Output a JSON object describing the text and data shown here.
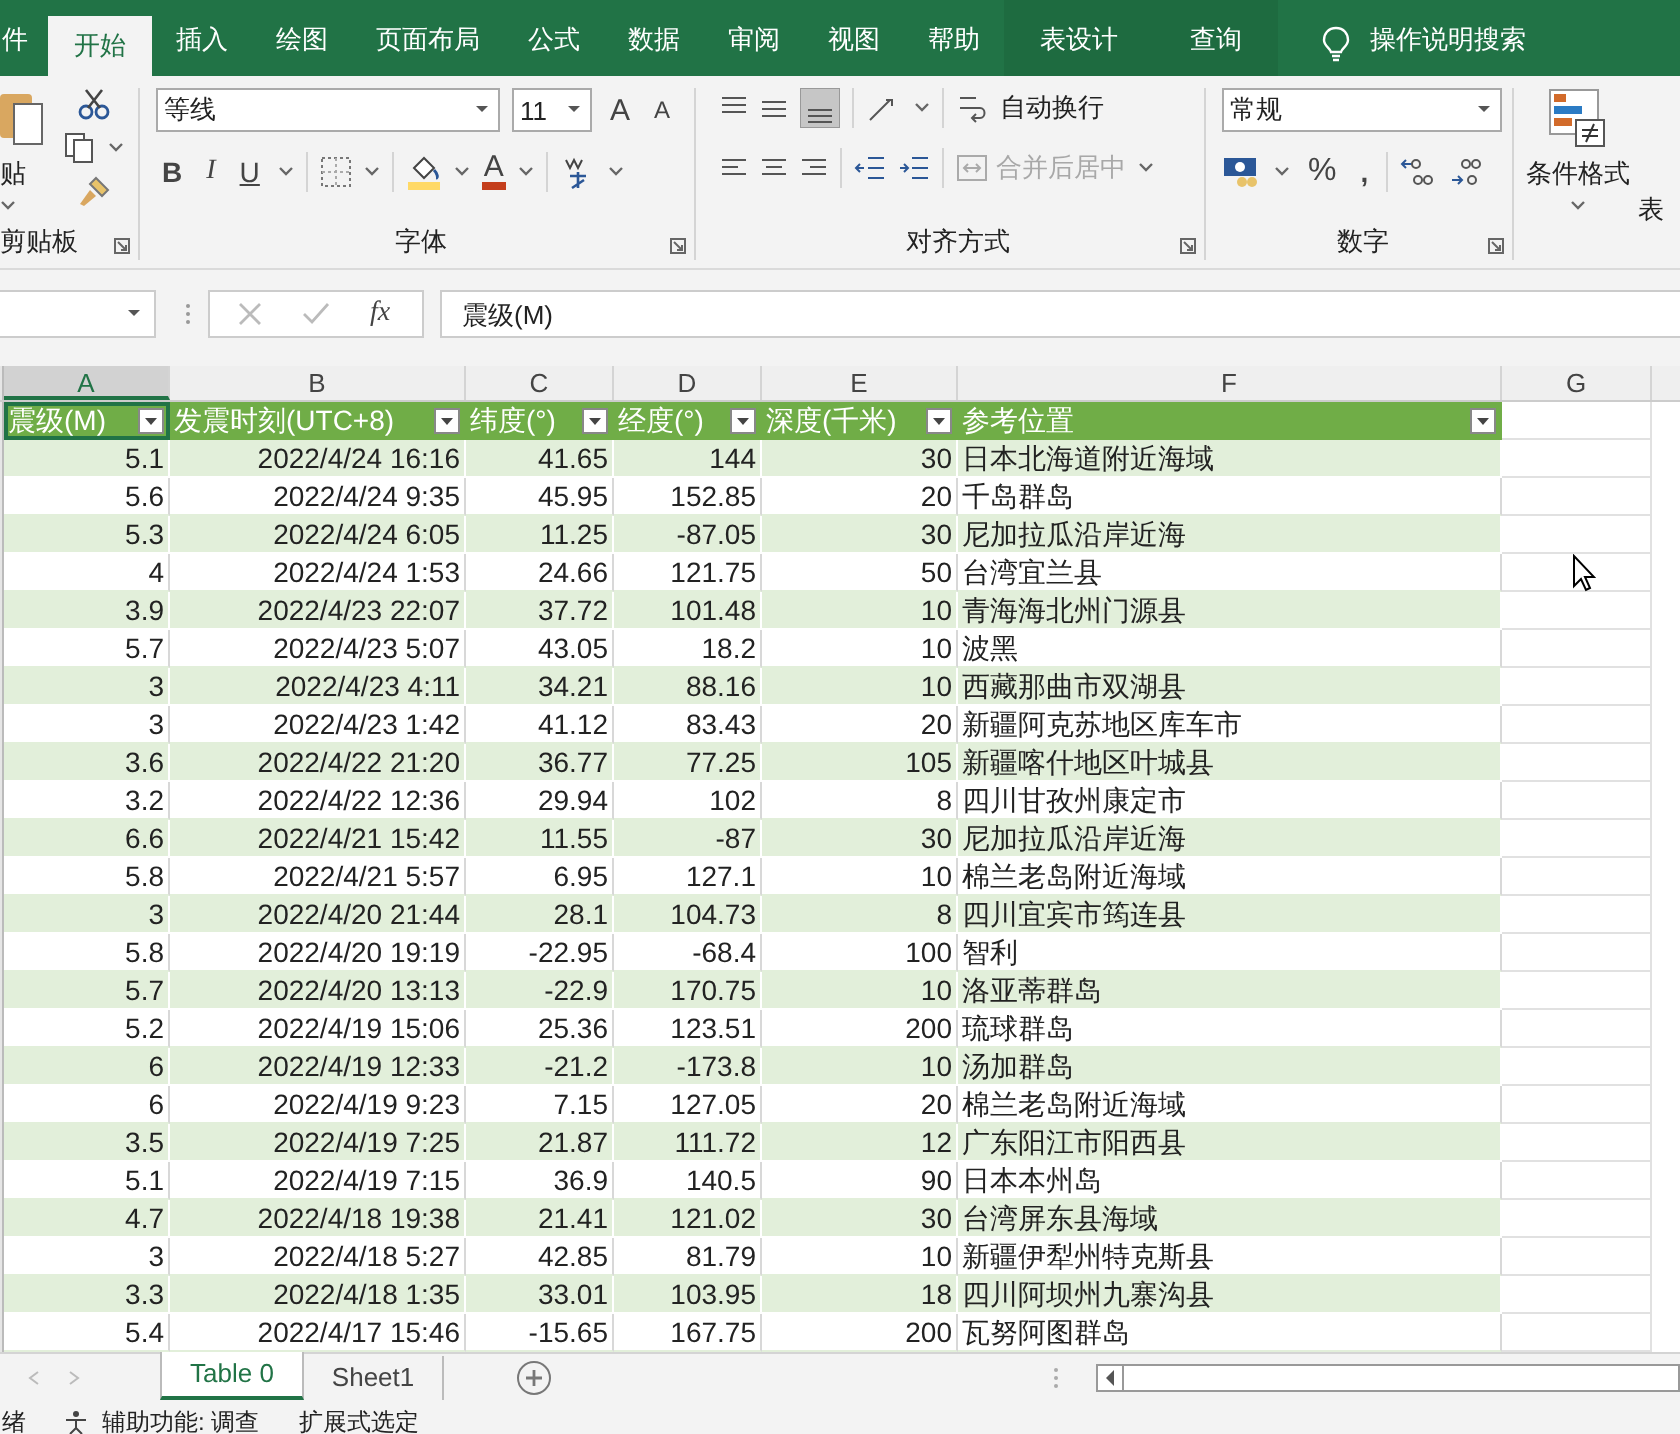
{
  "ribbon_tabs": [
    {
      "label": "件",
      "selected": false
    },
    {
      "label": "开始",
      "selected": true
    },
    {
      "label": "插入",
      "selected": false
    },
    {
      "label": "绘图",
      "selected": false
    },
    {
      "label": "页面布局",
      "selected": false
    },
    {
      "label": "公式",
      "selected": false
    },
    {
      "label": "数据",
      "selected": false
    },
    {
      "label": "审阅",
      "selected": false
    },
    {
      "label": "视图",
      "selected": false
    },
    {
      "label": "帮助",
      "selected": false
    },
    {
      "label": "表设计",
      "selected": false,
      "contextual": true
    },
    {
      "label": "查询",
      "selected": false,
      "contextual": true
    }
  ],
  "tell_me": "操作说明搜索",
  "clipboard": {
    "paste": "贴",
    "label": "剪贴板"
  },
  "font": {
    "name": "等线",
    "size": "11",
    "grow": "A",
    "shrink": "A",
    "bold": "B",
    "italic": "I",
    "underline": "U",
    "color_letter": "A",
    "label": "字体"
  },
  "alignment": {
    "wrap": "自动换行",
    "merge": {
      "label": "合并后居中",
      "disabled": true
    },
    "label": "对齐方式"
  },
  "number": {
    "format": "常规",
    "percent": "%",
    "comma": ",",
    "label": "数字"
  },
  "styles": {
    "conditional": "条件格式",
    "table_format": "表"
  },
  "formula_bar": {
    "fx": "fx",
    "value": "震级(M)"
  },
  "column_letters": [
    {
      "label": "A",
      "selected": true
    },
    {
      "label": "B",
      "selected": false
    },
    {
      "label": "C",
      "selected": false
    },
    {
      "label": "D",
      "selected": false
    },
    {
      "label": "E",
      "selected": false
    },
    {
      "label": "F",
      "selected": false
    },
    {
      "label": "G",
      "selected": false
    }
  ],
  "table": {
    "columns": [
      "震级(M)",
      "发震时刻(UTC+8)",
      "纬度(°)",
      "经度(°)",
      "深度(千米)",
      "参考位置"
    ],
    "rows": [
      [
        "5.1",
        "2022/4/24 16:16",
        "41.65",
        "144",
        "30",
        "日本北海道附近海域"
      ],
      [
        "5.6",
        "2022/4/24 9:35",
        "45.95",
        "152.85",
        "20",
        "千岛群岛"
      ],
      [
        "5.3",
        "2022/4/24 6:05",
        "11.25",
        "-87.05",
        "30",
        "尼加拉瓜沿岸近海"
      ],
      [
        "4",
        "2022/4/24 1:53",
        "24.66",
        "121.75",
        "50",
        "台湾宜兰县"
      ],
      [
        "3.9",
        "2022/4/23 22:07",
        "37.72",
        "101.48",
        "10",
        "青海海北州门源县"
      ],
      [
        "5.7",
        "2022/4/23 5:07",
        "43.05",
        "18.2",
        "10",
        "波黑"
      ],
      [
        "3",
        "2022/4/23 4:11",
        "34.21",
        "88.16",
        "10",
        "西藏那曲市双湖县"
      ],
      [
        "3",
        "2022/4/23 1:42",
        "41.12",
        "83.43",
        "20",
        "新疆阿克苏地区库车市"
      ],
      [
        "3.6",
        "2022/4/22 21:20",
        "36.77",
        "77.25",
        "105",
        "新疆喀什地区叶城县"
      ],
      [
        "3.2",
        "2022/4/22 12:36",
        "29.94",
        "102",
        "8",
        "四川甘孜州康定市"
      ],
      [
        "6.6",
        "2022/4/21 15:42",
        "11.55",
        "-87",
        "30",
        "尼加拉瓜沿岸近海"
      ],
      [
        "5.8",
        "2022/4/21 5:57",
        "6.95",
        "127.1",
        "10",
        "棉兰老岛附近海域"
      ],
      [
        "3",
        "2022/4/20 21:44",
        "28.1",
        "104.73",
        "8",
        "四川宜宾市筠连县"
      ],
      [
        "5.8",
        "2022/4/20 19:19",
        "-22.95",
        "-68.4",
        "100",
        "智利"
      ],
      [
        "5.7",
        "2022/4/20 13:13",
        "-22.9",
        "170.75",
        "10",
        "洛亚蒂群岛"
      ],
      [
        "5.2",
        "2022/4/19 15:06",
        "25.36",
        "123.51",
        "200",
        "琉球群岛"
      ],
      [
        "6",
        "2022/4/19 12:33",
        "-21.2",
        "-173.8",
        "10",
        "汤加群岛"
      ],
      [
        "6",
        "2022/4/19 9:23",
        "7.15",
        "127.05",
        "20",
        "棉兰老岛附近海域"
      ],
      [
        "3.5",
        "2022/4/19 7:25",
        "21.87",
        "111.72",
        "12",
        "广东阳江市阳西县"
      ],
      [
        "5.1",
        "2022/4/19 7:15",
        "36.9",
        "140.5",
        "90",
        "日本本州岛"
      ],
      [
        "4.7",
        "2022/4/18 19:38",
        "21.41",
        "121.02",
        "30",
        "台湾屏东县海域"
      ],
      [
        "3",
        "2022/4/18 5:27",
        "42.85",
        "81.79",
        "10",
        "新疆伊犁州特克斯县"
      ],
      [
        "3.3",
        "2022/4/18 1:35",
        "33.01",
        "103.95",
        "18",
        "四川阿坝州九寨沟县"
      ],
      [
        "5.4",
        "2022/4/17 15:46",
        "-15.65",
        "167.75",
        "200",
        "瓦努阿图群岛"
      ]
    ]
  },
  "sheet_tabs": [
    {
      "label": "Table 0",
      "selected": true
    },
    {
      "label": "Sheet1",
      "selected": false
    }
  ],
  "status_bar": [
    "绪",
    "辅助功能: 调查",
    "扩展式选定"
  ]
}
